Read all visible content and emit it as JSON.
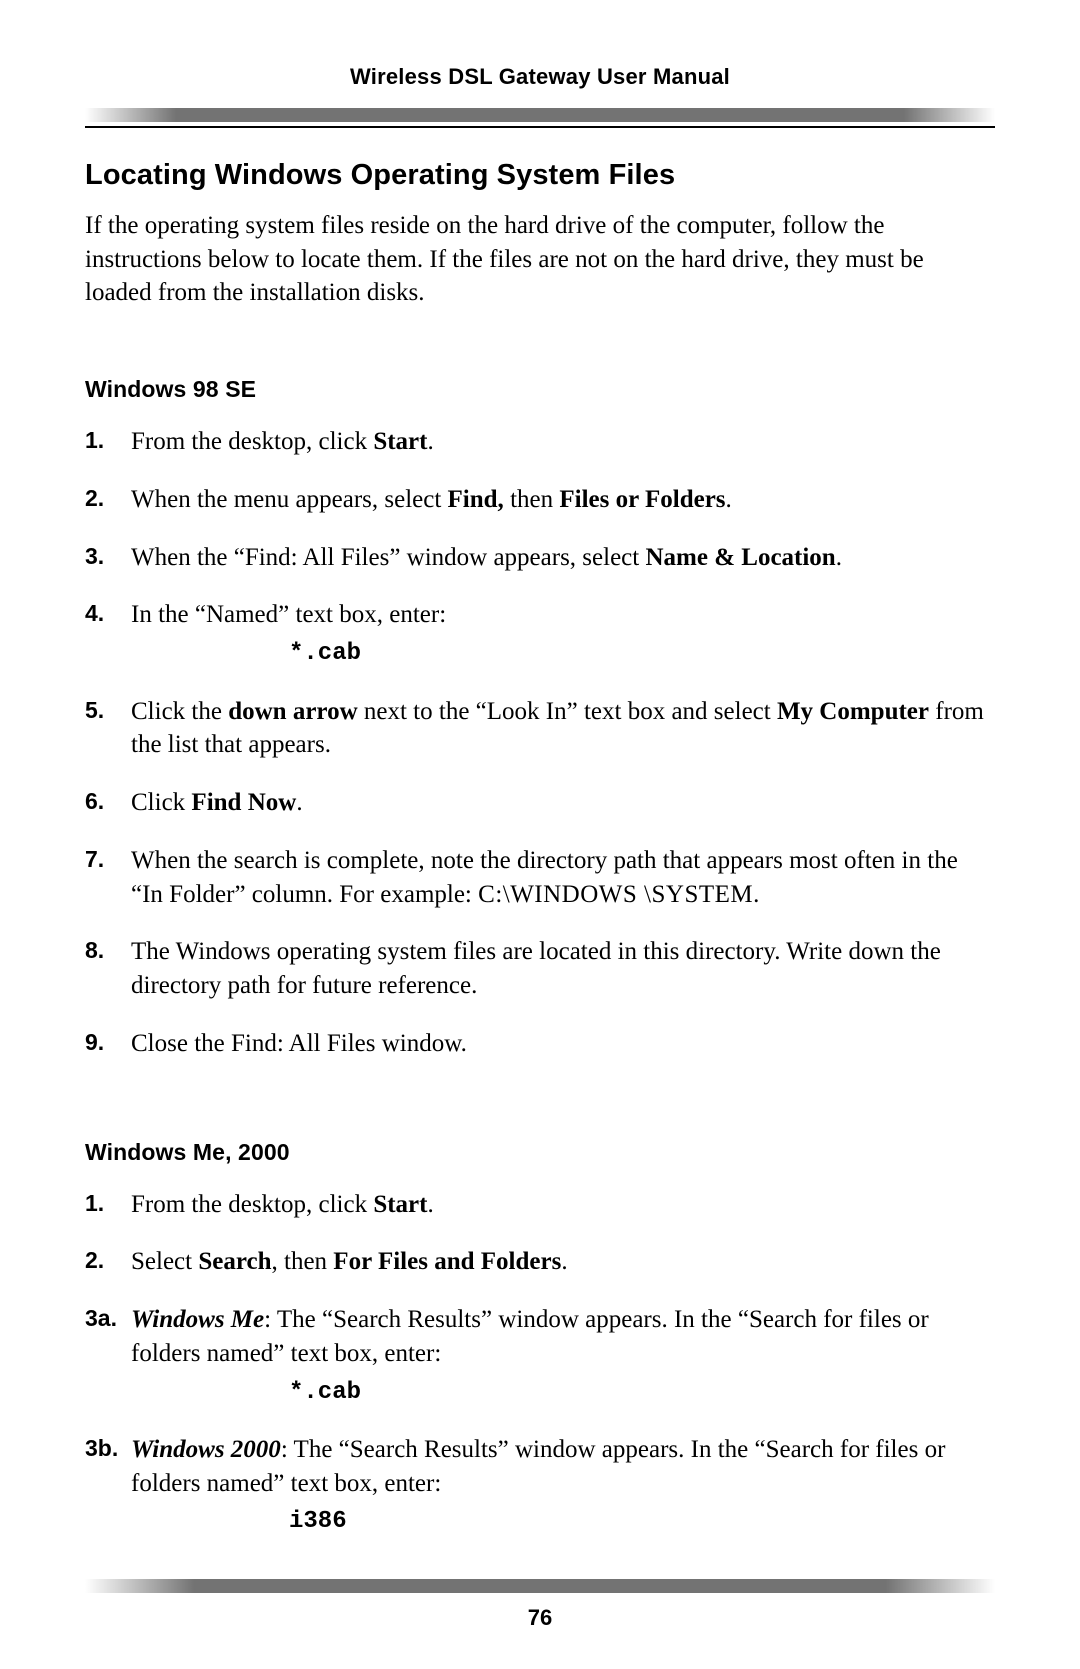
{
  "header": {
    "title": "Wireless DSL Gateway User Manual"
  },
  "section": {
    "title": "Locating Windows Operating System Files",
    "intro": "If the operating system files reside on the hard drive of the computer, follow the instructions below to locate them. If the files are not on the hard drive, they must be loaded from the installation disks."
  },
  "win98": {
    "heading": "Windows 98 SE",
    "items": {
      "n1": "1.",
      "t1a": "From the desktop, click ",
      "t1b": "Start",
      "t1c": ".",
      "n2": "2.",
      "t2a": "When the menu appears, select ",
      "t2b": "Find,",
      "t2c": " then ",
      "t2d": "Files or Folders",
      "t2e": ".",
      "n3": "3.",
      "t3a": "When the “Find: All Files” window appears, select ",
      "t3b": "Name & Location",
      "t3c": ".",
      "n4": "4.",
      "t4a": "In the “Named” text box, enter:",
      "t4code": "*.cab",
      "n5": "5.",
      "t5a": "Click the ",
      "t5b": "down arrow",
      "t5c": " next to the “Look In” text box and select ",
      "t5d": "My Computer",
      "t5e": " from the list that appears.",
      "n6": "6.",
      "t6a": "Click ",
      "t6b": "Find Now",
      "t6c": ".",
      "n7": "7.",
      "t7a": "  When the search is complete, note the directory path that appears most often in the “In Folder” column. For example: ",
      "t7b": "C:\\WINDOWS \\SYSTEM",
      "t7c": ".",
      "n8": "8.",
      "t8": "The Windows operating system files are located in this directory. Write down the directory path for future reference.",
      "n9": "9.",
      "t9": "  Close the Find: All Files window."
    }
  },
  "winme": {
    "heading": "Windows Me, 2000",
    "items": {
      "n1": "1.",
      "t1a": "From the desktop, click ",
      "t1b": "Start",
      "t1c": ".",
      "n2": "2.",
      "t2a": "Select ",
      "t2b": "Search",
      "t2c": ", then ",
      "t2d": "For Files and Folders",
      "t2e": ".",
      "n3a": "3a.",
      "t3a_os": "Windows Me",
      "t3a_rest": ": The “Search Results” window appears. In the “Search for files or folders named” text box, enter:",
      "t3a_code": "*.cab",
      "n3b": "3b.",
      "t3b_os": "Windows 2000",
      "t3b_rest": ": The “Search Results” window appears. In the “Search for files or folders named” text box, enter:",
      "t3b_code": "i386"
    }
  },
  "footer": {
    "page": "76"
  }
}
